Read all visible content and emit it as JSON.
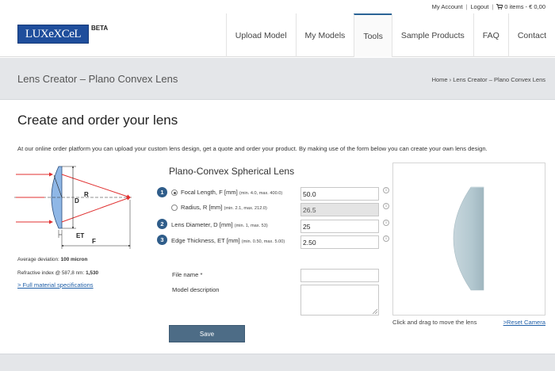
{
  "topbar": {
    "my_account": "My Account",
    "logout": "Logout",
    "cart": "0 items - € 0,00"
  },
  "header": {
    "logo_text": "LUXeXCeL",
    "beta": "BETA",
    "nav": [
      {
        "label": "Upload Model",
        "active": false
      },
      {
        "label": "My Models",
        "active": false
      },
      {
        "label": "Tools",
        "active": true
      },
      {
        "label": "Sample Products",
        "active": false
      },
      {
        "label": "FAQ",
        "active": false
      },
      {
        "label": "Contact",
        "active": false
      }
    ]
  },
  "banner": {
    "title": "Lens Creator – Plano Convex Lens",
    "breadcrumb": "Home › Lens Creator – Plano Convex Lens"
  },
  "main": {
    "heading": "Create and order your lens",
    "intro": "At our online order platform you can upload your custom lens design, get a quote and order your product. By making use of the form below you can create your own lens design."
  },
  "diagram": {
    "label_r": "R",
    "label_d": "D",
    "label_et": "ET",
    "label_f": "F"
  },
  "material": {
    "deviation_label": "Average deviation:",
    "deviation_value": "100 micron",
    "index_label": "Refractive index @ 587,8 nm:",
    "index_value": "1,530",
    "spec_link": "> Full material specifications"
  },
  "form": {
    "title": "Plano-Convex Spherical Lens",
    "steps": [
      "1",
      "2",
      "3"
    ],
    "focal_label": "Focal Length, F [mm]",
    "focal_hint": "(min. 4.0, max. 400.0)",
    "focal_value": "50.0",
    "radius_label": "Radius, R [mm]",
    "radius_hint": "(min. 2.1, max. 212.0)",
    "radius_value": "26.5",
    "diameter_label": "Lens Diameter, D [mm]",
    "diameter_hint": "(min. 1, max. 53)",
    "diameter_value": "25",
    "edge_label": "Edge Thickness, ET [mm]",
    "edge_hint": "(min. 0.50, max. 5.00)",
    "edge_value": "2.50",
    "info_glyph": "i",
    "file_label": "File name *",
    "desc_label": "Model description",
    "save": "Save"
  },
  "viewer": {
    "note": "Click and drag to move the lens",
    "reset": ">Reset Camera"
  },
  "colors": {
    "accent": "#2f5d8a",
    "button": "#4d6c86",
    "banner": "#e4e6e9",
    "logo": "#1f4e9c",
    "ray": "#e03030",
    "lens": "#8fb7e6"
  }
}
